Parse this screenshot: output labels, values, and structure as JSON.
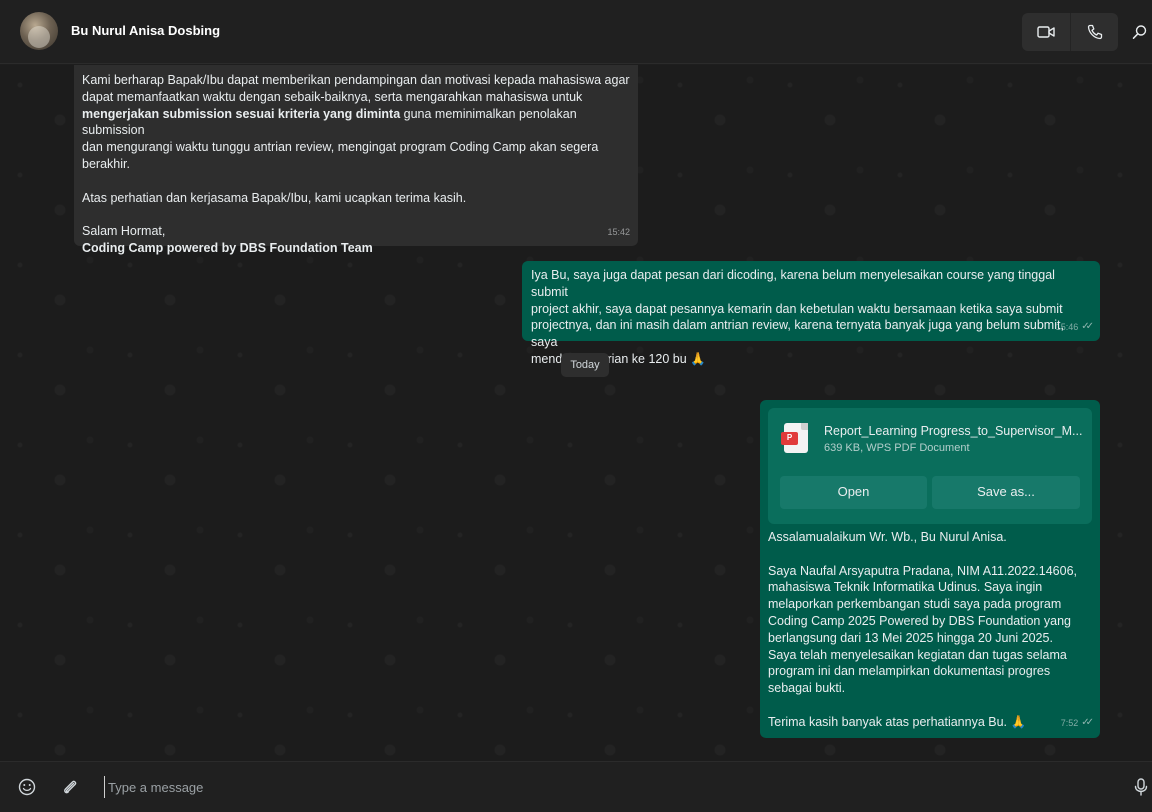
{
  "header": {
    "contact_name": "Bu Nurul Anisa Dosbing",
    "icons": [
      "video-call-icon",
      "voice-call-icon",
      "search-icon"
    ]
  },
  "messages": {
    "m1": {
      "l1": "Kami berharap Bapak/Ibu dapat memberikan pendampingan dan motivasi kepada mahasiswa agar",
      "l2": "dapat memanfaatkan waktu dengan sebaik-baiknya, serta mengarahkan mahasiswa untuk",
      "l3_bold": "mengerjakan submission sesuai kriteria yang diminta",
      "l3_rest": " guna meminimalkan penolakan submission",
      "l4": "dan mengurangi waktu tunggu antrian review, mengingat program Coding Camp akan segera",
      "l5": "berakhir.",
      "l6": "Atas perhatian dan kerjasama Bapak/Ibu, kami ucapkan terima kasih.",
      "l7": "Salam Hormat,",
      "l8": "Coding Camp powered by DBS Foundation Team",
      "time": "15:42"
    },
    "m2": {
      "l1": "Iya Bu, saya juga dapat pesan dari dicoding, karena belum menyelesaikan course yang tinggal submit",
      "l2": "project akhir, saya dapat pesannya kemarin dan kebetulan waktu bersamaan ketika saya submit",
      "l3": "projectnya, dan ini masih dalam antrian review, karena ternyata banyak juga yang belum submit, saya",
      "l4": "mendapat antrian ke 120 bu 🙏",
      "time": "15:46",
      "ticks": "✓✓"
    },
    "date_chip": "Today",
    "m3": {
      "doc_name": "Report_Learning Progress_to_Supervisor_M...",
      "doc_meta": "639 KB, WPS PDF Document",
      "doc_icon": "pdf-file-icon",
      "open_label": "Open",
      "save_label": "Save as...",
      "l1": "Assalamualaikum Wr. Wb., Bu Nurul Anisa.",
      "l2": "Saya Naufal Arsyaputra Pradana, NIM A11.2022.14606,",
      "l3": "mahasiswa Teknik Informatika Udinus. Saya ingin",
      "l4": "melaporkan perkembangan studi saya pada program",
      "l5": "Coding Camp 2025 Powered by DBS Foundation yang",
      "l6": "berlangsung dari 13 Mei 2025 hingga 20 Juni 2025.",
      "l7": "Saya telah menyelesaikan kegiatan dan tugas selama",
      "l8": "program ini dan melampirkan dokumentasi progres",
      "l9": "sebagai bukti.",
      "l10": "Terima kasih banyak atas perhatiannya Bu. 🙏",
      "time": "7:52",
      "ticks": "✓✓"
    }
  },
  "composer": {
    "placeholder": "Type a message",
    "icons": [
      "emoji-icon",
      "attach-icon",
      "microphone-icon"
    ]
  },
  "colors": {
    "incoming_bubble": "#2e2e2e",
    "outgoing_bubble": "#005c4b",
    "header_bg": "#202020",
    "chat_bg": "#1c1c1c"
  }
}
